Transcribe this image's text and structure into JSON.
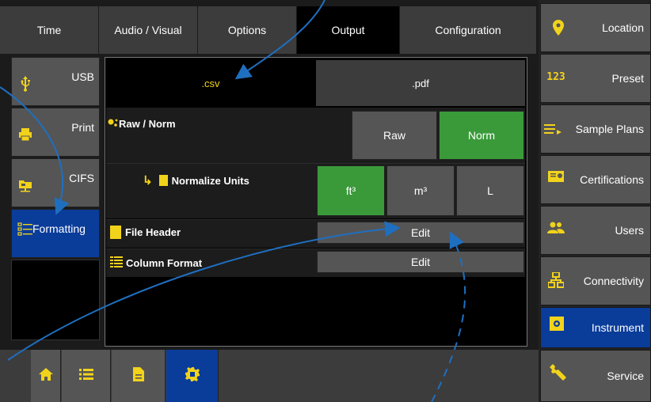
{
  "top_tabs": [
    "Time",
    "Audio / Visual",
    "Options",
    "Output",
    "Configuration"
  ],
  "left_nav": [
    "USB",
    "Print",
    "CIFS",
    "Formatting"
  ],
  "format_tabs": [
    ".csv",
    ".pdf"
  ],
  "rows": {
    "raw_norm": {
      "label": "Raw / Norm",
      "options": [
        "Raw",
        "Norm"
      ]
    },
    "normalize_units": {
      "label": "Normalize Units",
      "options": [
        "ft³",
        "m³",
        "L"
      ]
    },
    "file_header": {
      "label": "File Header",
      "button": "Edit"
    },
    "column_format": {
      "label": "Column Format",
      "button": "Edit"
    }
  },
  "right_nav": [
    "Location",
    "Preset",
    "Sample Plans",
    "Certifications",
    "Users",
    "Connectivity",
    "Instrument",
    "Service"
  ],
  "bottom_bar": [
    "home-icon",
    "list-icon",
    "document-icon",
    "gear-icon"
  ],
  "colors": {
    "accent_yellow": "#f2d31b",
    "selected_blue": "#0a3c9a",
    "selected_green": "#3a9a3a",
    "annotation_blue": "#1f6fc0"
  }
}
